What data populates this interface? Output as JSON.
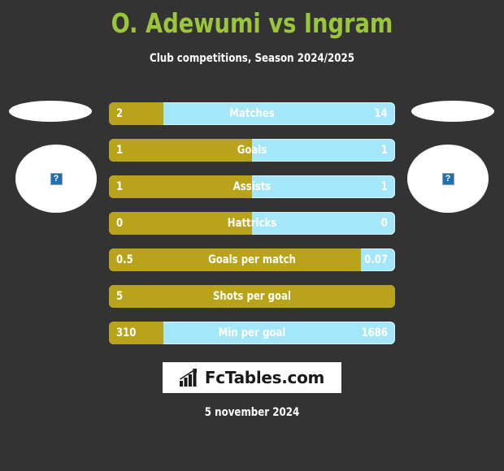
{
  "header": {
    "title": "O. Adewumi vs Ingram",
    "subtitle": "Club competitions, Season 2024/2025"
  },
  "colors": {
    "background": "#333333",
    "title": "#9ac63c",
    "home_bar": "#b8a31a",
    "away_bar": "#a5e7fa",
    "text": "#ffffff"
  },
  "players": {
    "home": {
      "flag_placeholder": "broken-image",
      "photo_placeholder": "broken-image",
      "placeholder_glyph": "?"
    },
    "away": {
      "flag_placeholder": "broken-image",
      "photo_placeholder": "broken-image",
      "placeholder_glyph": "?"
    }
  },
  "chart_data": {
    "type": "bar",
    "title": "O. Adewumi vs Ingram",
    "subtitle": "Club competitions, Season 2024/2025",
    "orientation": "horizontal-diverging",
    "categories": [
      "Matches",
      "Goals",
      "Assists",
      "Hattricks",
      "Goals per match",
      "Shots per goal",
      "Min per goal"
    ],
    "series": [
      {
        "name": "O. Adewumi",
        "color": "#b8a31a",
        "values": [
          2,
          1,
          1,
          0,
          0.5,
          5,
          310
        ],
        "display": [
          "2",
          "1",
          "1",
          "0",
          "0.5",
          "5",
          "310"
        ]
      },
      {
        "name": "Ingram",
        "color": "#a5e7fa",
        "values": [
          14,
          1,
          1,
          0,
          0.07,
          null,
          1686
        ],
        "display": [
          "14",
          "1",
          "1",
          "0",
          "0.07",
          "",
          "1686"
        ]
      }
    ],
    "home_share_pct": [
      19,
      50,
      50,
      50,
      88,
      100,
      19
    ],
    "legend": "position: implicit (left = O. Adewumi, right = Ingram)",
    "grid": false
  },
  "rows": [
    {
      "label": "Matches",
      "home": "2",
      "away": "14",
      "home_pct": 19
    },
    {
      "label": "Goals",
      "home": "1",
      "away": "1",
      "home_pct": 50
    },
    {
      "label": "Assists",
      "home": "1",
      "away": "1",
      "home_pct": 50
    },
    {
      "label": "Hattricks",
      "home": "0",
      "away": "0",
      "home_pct": 50
    },
    {
      "label": "Goals per match",
      "home": "0.5",
      "away": "0.07",
      "home_pct": 88
    },
    {
      "label": "Shots per goal",
      "home": "5",
      "away": "",
      "home_pct": 100
    },
    {
      "label": "Min per goal",
      "home": "310",
      "away": "1686",
      "home_pct": 19
    }
  ],
  "footer": {
    "logo_text": "FcTables.com",
    "logo_icon": "bar-chart-growth-icon",
    "date": "5 november 2024"
  }
}
